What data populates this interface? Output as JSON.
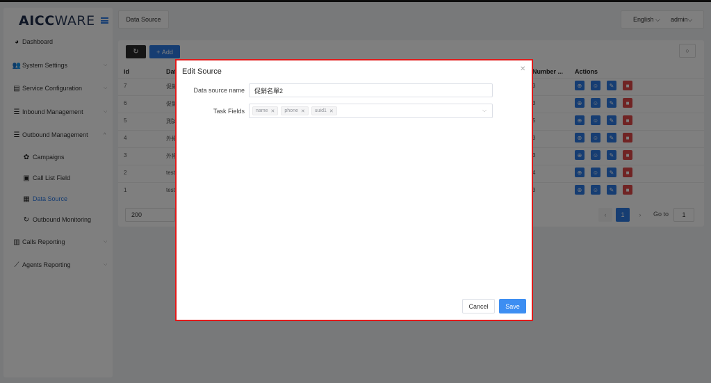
{
  "brand": {
    "logo_bold": "AICC",
    "logo_rest": "WARE"
  },
  "sidebar": {
    "items": [
      {
        "label": "Dashboard",
        "icon": "dashboard-icon",
        "chevron": ""
      },
      {
        "label": "System Settings",
        "icon": "users-icon",
        "chevron": "⌵"
      },
      {
        "label": "Service Configuration",
        "icon": "id-card-icon",
        "chevron": "⌵"
      },
      {
        "label": "Inbound Management",
        "icon": "list-icon",
        "chevron": "⌵"
      },
      {
        "label": "Outbound Management",
        "icon": "list-icon",
        "chevron": "^"
      },
      {
        "label": "Campaigns",
        "icon": "campaign-icon"
      },
      {
        "label": "Call List Field",
        "icon": "file-icon"
      },
      {
        "label": "Data Source",
        "icon": "grid-icon"
      },
      {
        "label": "Outbound Monitoring",
        "icon": "refresh-icon"
      },
      {
        "label": "Calls Reporting",
        "icon": "bar-chart-icon",
        "chevron": "⌵"
      },
      {
        "label": "Agents Reporting",
        "icon": "line-chart-icon",
        "chevron": "⌵"
      }
    ]
  },
  "header": {
    "tab": "Data Source",
    "language": "English",
    "user": "admin"
  },
  "toolbar": {
    "add_label": "Add"
  },
  "table": {
    "headers": [
      "id",
      "Dat",
      "Number ...",
      "Actions"
    ],
    "rows": [
      {
        "id": "7",
        "data": "促銷",
        "number": "3"
      },
      {
        "id": "6",
        "data": "促銷",
        "number": "3"
      },
      {
        "id": "5",
        "data": "測試",
        "number": "5"
      },
      {
        "id": "4",
        "data": "外撥",
        "number": "3"
      },
      {
        "id": "3",
        "data": "外撥",
        "number": "3"
      },
      {
        "id": "2",
        "data": "test",
        "number": "4"
      },
      {
        "id": "1",
        "data": "test",
        "number": "3"
      }
    ]
  },
  "pagination": {
    "page_size": "200",
    "current_page": "1",
    "goto_label": "Go to",
    "goto_value": "1"
  },
  "dialog": {
    "title": "Edit Source",
    "name_label": "Data source name",
    "name_value": "促銷名單2",
    "fields_label": "Task Fields",
    "tags": [
      "name",
      "phone",
      "uuid1"
    ],
    "cancel_label": "Cancel",
    "save_label": "Save"
  },
  "colors": {
    "primary": "#2d7be5",
    "danger": "#e04949",
    "highlight_border": "#e11919"
  }
}
